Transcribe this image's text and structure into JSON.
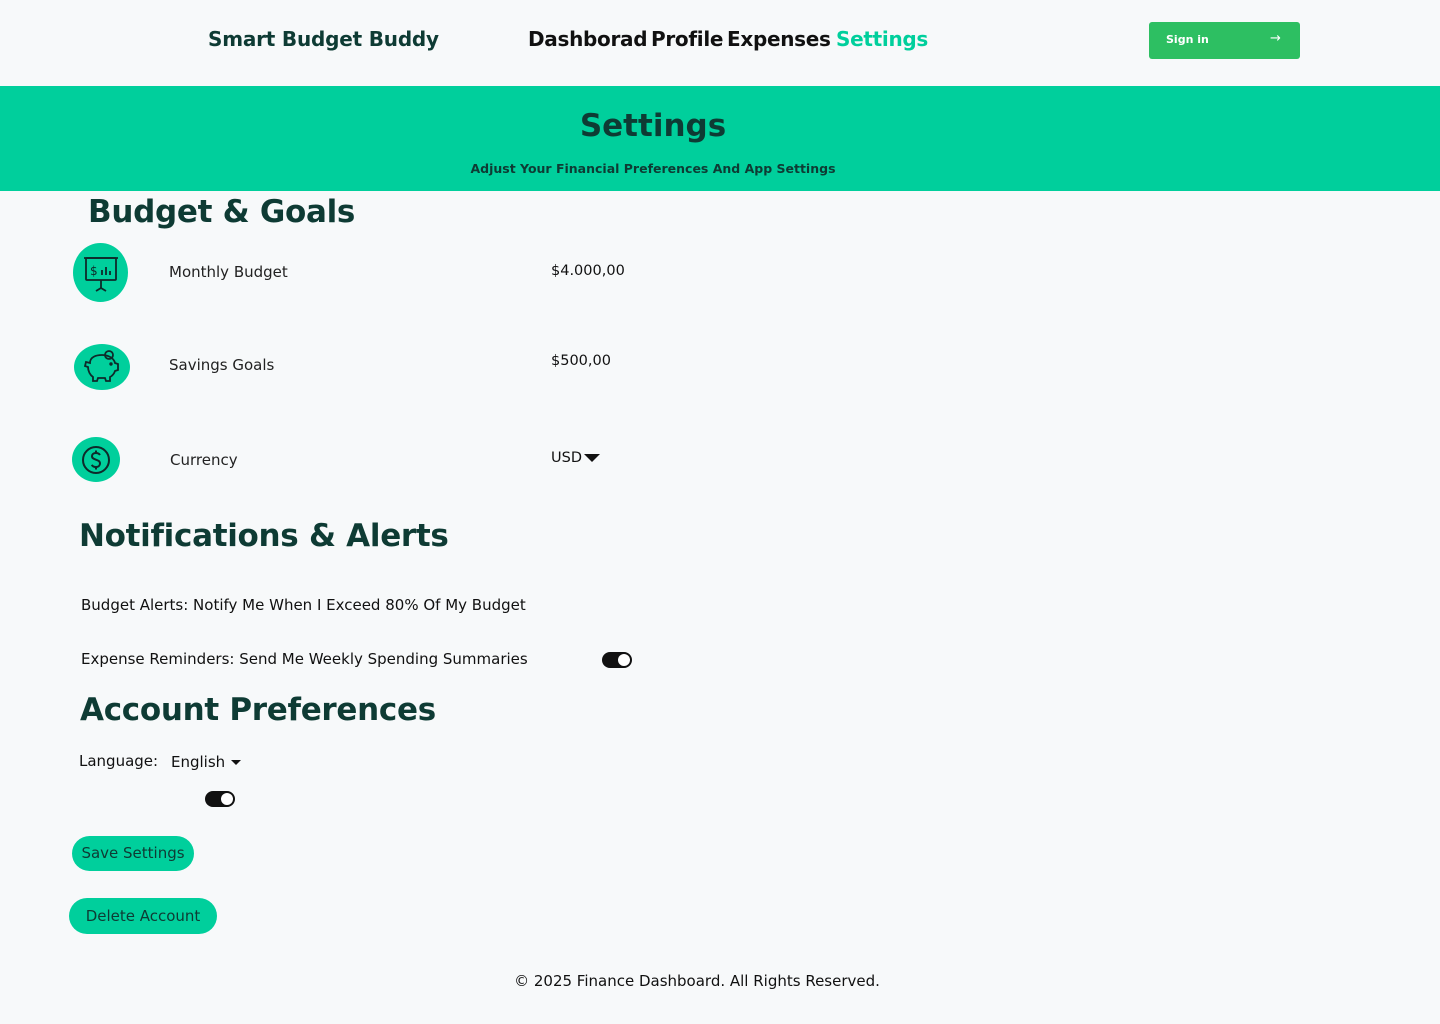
{
  "nav": {
    "brand": "Smart Budget Buddy",
    "links": [
      "Dashborad",
      "Profile",
      "Expenses",
      "Settings"
    ],
    "active": "Settings",
    "signin_label": "Sign in",
    "accent": "#00cf9c",
    "signin_color": "#2dbf62"
  },
  "banner": {
    "title": "Settings",
    "subtitle": "Adjust Your Financial Preferences And App Settings",
    "color": "#00cf9c"
  },
  "budget": {
    "heading": "Budget & Goals",
    "rows": [
      {
        "icon": "presentation-chart-icon",
        "label": "Monthly Budget",
        "value": "$4.000,00"
      },
      {
        "icon": "piggy-bank-icon",
        "label": "Savings Goals",
        "value": "$500,00"
      },
      {
        "icon": "dollar-circle-icon",
        "label": "Currency",
        "value": "USD"
      }
    ]
  },
  "notifications": {
    "heading": "Notifications & Alerts",
    "items": [
      {
        "label": "Budget Alerts: Notify Me When I Exceed 80% Of My Budget"
      },
      {
        "label": "Expense Reminders: Send Me Weekly Spending Summaries"
      }
    ]
  },
  "account": {
    "heading": "Account Preferences",
    "language_label": "Language:",
    "language_value": "English"
  },
  "buttons": {
    "save": "Save Settings",
    "delete": "Delete Account"
  },
  "footer": {
    "text": "© 2025 Finance Dashboard. All Rights Reserved."
  }
}
